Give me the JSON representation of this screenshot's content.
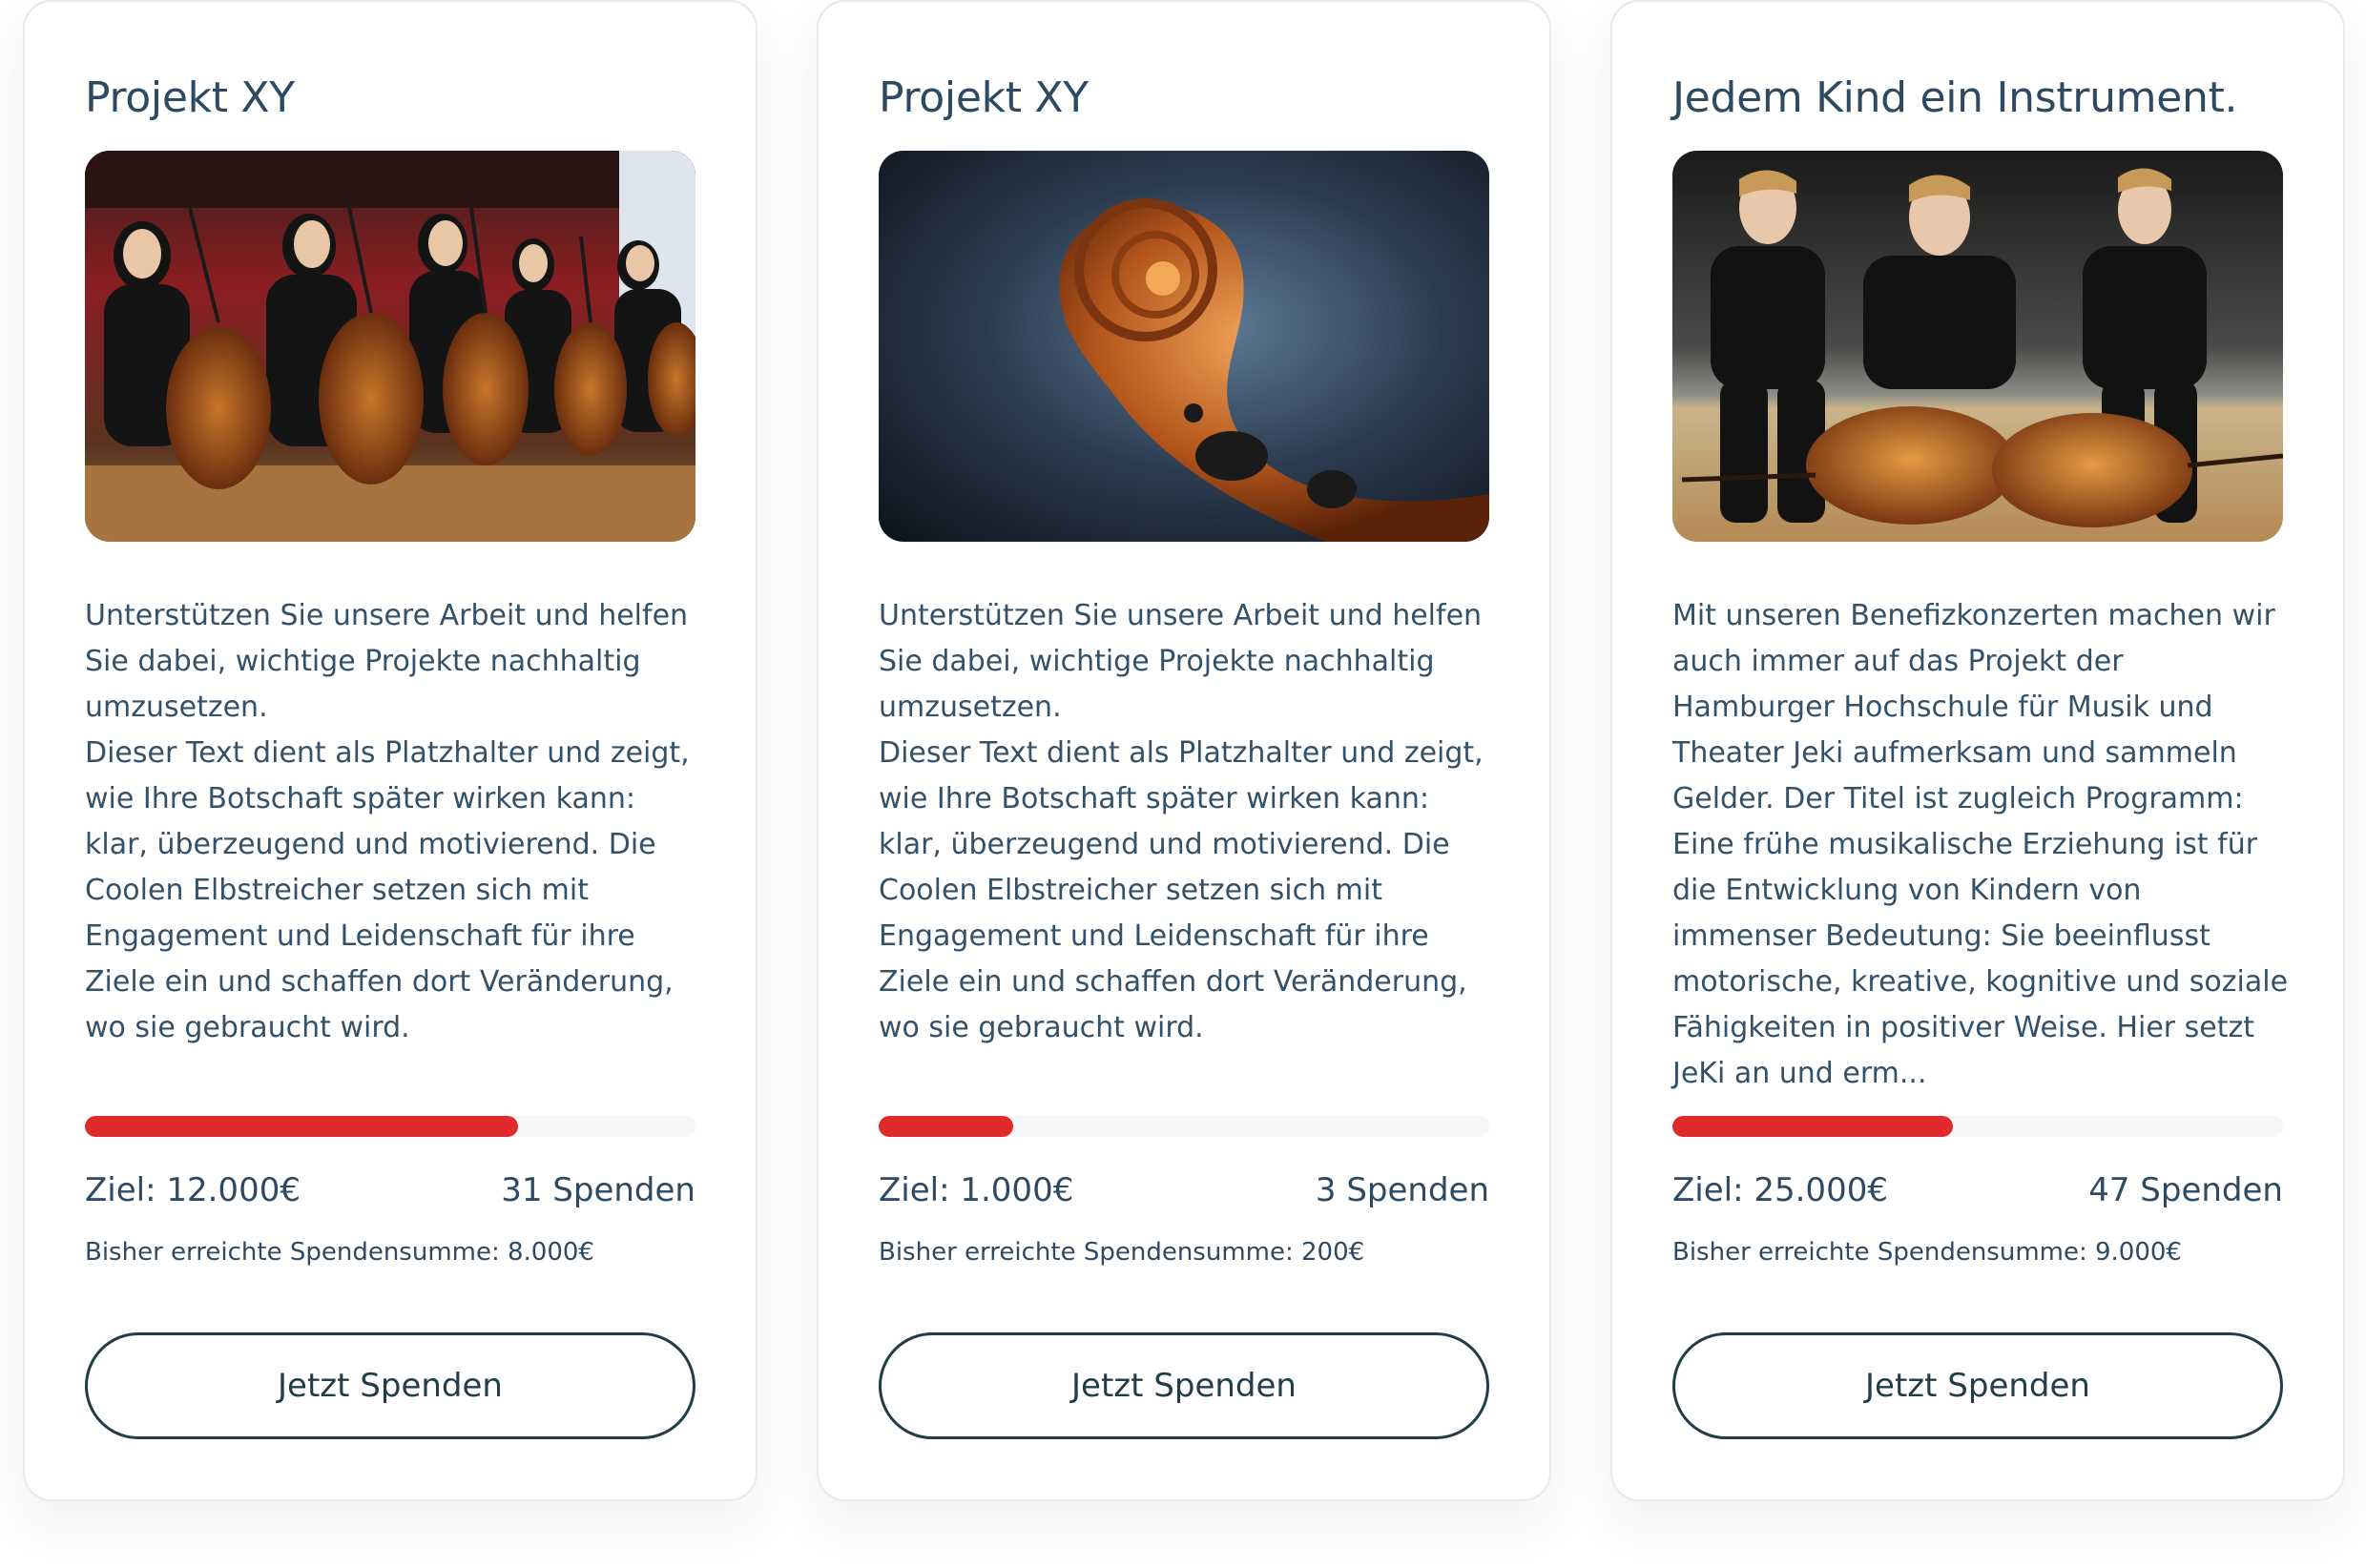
{
  "cards": [
    {
      "title": "Projekt XY",
      "image_icon": "cello-orchestra-photo",
      "text": "Unterstützen Sie unsere Arbeit und helfen Sie dabei, wichtige Projekte nachhaltig umzusetzen.\nDieser Text dient als Platzhalter und zeigt, wie Ihre Botschaft später wirken kann: klar, überzeugend und motivierend. Die Coolen Elbstreicher setzen sich mit Engagement und Leidenschaft für ihre Ziele ein und schaffen dort Veränderung, wo sie gebraucht wird.",
      "progress_fraction": 0.71,
      "goal": "Ziel: 12.000€",
      "donations": "31 Spenden",
      "raised": "Bisher erreichte Spendensumme: 8.000€",
      "button_label": "Jetzt Spenden"
    },
    {
      "title": "Projekt XY",
      "image_icon": "violin-scroll-photo",
      "text": "Unterstützen Sie unsere Arbeit und helfen Sie dabei, wichtige Projekte nachhaltig umzusetzen.\nDieser Text dient als Platzhalter und zeigt, wie Ihre Botschaft später wirken kann: klar, überzeugend und motivierend. Die Coolen Elbstreicher setzen sich mit Engagement und Leidenschaft für ihre Ziele ein und schaffen dort Veränderung, wo sie gebraucht wird.",
      "progress_fraction": 0.22,
      "goal": "Ziel: 1.000€",
      "donations": "3 Spenden",
      "raised": "Bisher erreichte Spendensumme: 200€",
      "button_label": "Jetzt Spenden"
    },
    {
      "title": "Jedem Kind ein Instrument.",
      "image_icon": "children-with-instruments-photo",
      "text": "Mit unseren Benefizkonzerten machen wir auch immer auf das Projekt der Hamburger Hochschule für Musik und Theater Jeki aufmerksam und sammeln Gelder. Der Titel ist zugleich Programm: Eine frühe musikalische Erziehung ist für die Entwicklung von Kindern von immenser Bedeutung: Sie beeinflusst motorische, kreative, kognitive und soziale Fähigkeiten in positiver Weise. Hier setzt JeKi an und erm...",
      "progress_fraction": 0.46,
      "goal": "Ziel: 25.000€",
      "donations": "47 Spenden",
      "raised": "Bisher erreichte Spendensumme: 9.000€",
      "button_label": "Jetzt Spenden"
    }
  ],
  "colors": {
    "progress": "#e02a2e",
    "track": "#f4f6f8",
    "text": "#2e4a63",
    "button_border": "#1f3d4a"
  }
}
